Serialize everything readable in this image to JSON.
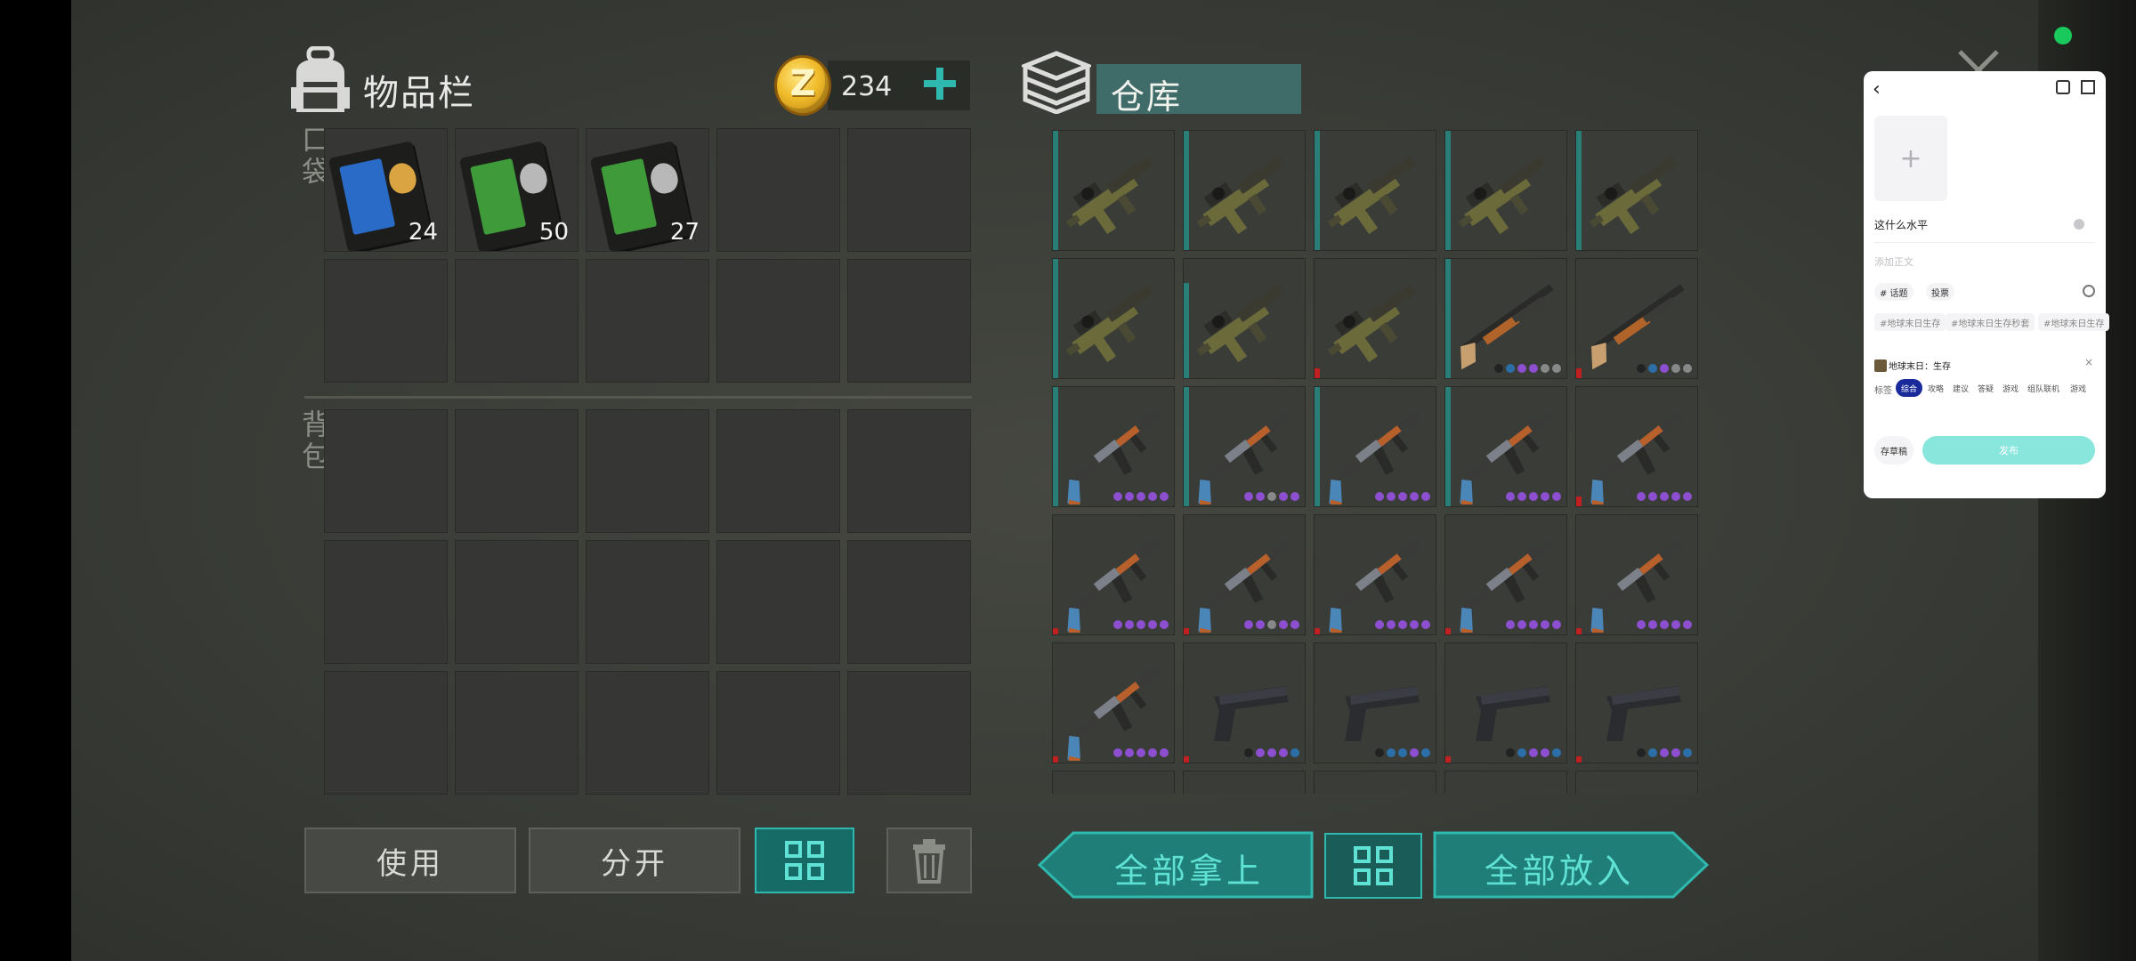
{
  "inventory": {
    "title": "物品栏",
    "pocket_label": "口袋",
    "backpack_label": "背包",
    "coins": "234",
    "pocket_slots": [
      {
        "type": "keycard-blue",
        "qty": "24"
      },
      {
        "type": "keycard-green",
        "qty": "50"
      },
      {
        "type": "keycard-green",
        "qty": "27"
      },
      {
        "type": "empty",
        "qty": ""
      },
      {
        "type": "empty",
        "qty": ""
      },
      {
        "type": "empty",
        "qty": ""
      },
      {
        "type": "empty",
        "qty": ""
      },
      {
        "type": "empty",
        "qty": ""
      },
      {
        "type": "empty",
        "qty": ""
      },
      {
        "type": "empty",
        "qty": ""
      }
    ],
    "backpack_slot_count": 15
  },
  "warehouse": {
    "title": "仓库",
    "items": [
      {
        "type": "grenade-launcher",
        "bar": "#2a7e78",
        "bar_h": 1.0,
        "dots": []
      },
      {
        "type": "grenade-launcher",
        "bar": "#2a7e78",
        "bar_h": 1.0,
        "dots": []
      },
      {
        "type": "grenade-launcher",
        "bar": "#2a7e78",
        "bar_h": 1.0,
        "dots": []
      },
      {
        "type": "grenade-launcher",
        "bar": "#2a7e78",
        "bar_h": 1.0,
        "dots": []
      },
      {
        "type": "grenade-launcher",
        "bar": "#2a7e78",
        "bar_h": 1.0,
        "dots": []
      },
      {
        "type": "grenade-launcher",
        "bar": "#2a7e78",
        "bar_h": 1.0,
        "dots": []
      },
      {
        "type": "grenade-launcher",
        "bar": "#2a7e78",
        "bar_h": 0.8,
        "dots": []
      },
      {
        "type": "grenade-launcher",
        "bar": "#c02020",
        "bar_h": 0.08,
        "dots": []
      },
      {
        "type": "shotgun",
        "bar": "#2a7e78",
        "bar_h": 1.0,
        "dots": [
          "#222",
          "#2c6fa8",
          "#8c4fd0",
          "#8c4fd0",
          "#888888",
          "#888888"
        ]
      },
      {
        "type": "shotgun",
        "bar": "#c02020",
        "bar_h": 0.08,
        "dots": [
          "#222",
          "#2c6fa8",
          "#8c4fd0",
          "#888888",
          "#888888"
        ]
      },
      {
        "type": "ak",
        "bar": "#2a7e78",
        "bar_h": 1.0,
        "dots": [
          "#8c4fd0",
          "#8c4fd0",
          "#8c4fd0",
          "#8c4fd0",
          "#8c4fd0"
        ]
      },
      {
        "type": "ak",
        "bar": "#2a7e78",
        "bar_h": 1.0,
        "dots": [
          "#8c4fd0",
          "#8c4fd0",
          "#888888",
          "#8c4fd0",
          "#8c4fd0"
        ]
      },
      {
        "type": "ak",
        "bar": "#2a7e78",
        "bar_h": 1.0,
        "dots": [
          "#8c4fd0",
          "#8c4fd0",
          "#8c4fd0",
          "#8c4fd0",
          "#8c4fd0"
        ]
      },
      {
        "type": "ak",
        "bar": "#2a7e78",
        "bar_h": 1.0,
        "dots": [
          "#8c4fd0",
          "#8c4fd0",
          "#8c4fd0",
          "#8c4fd0",
          "#8c4fd0"
        ]
      },
      {
        "type": "ak",
        "bar": "#c02020",
        "bar_h": 0.08,
        "dots": [
          "#8c4fd0",
          "#8c4fd0",
          "#8c4fd0",
          "#8c4fd0",
          "#8c4fd0"
        ]
      },
      {
        "type": "ak",
        "bar": "#c02020",
        "bar_h": 0.05,
        "dots": [
          "#8c4fd0",
          "#8c4fd0",
          "#8c4fd0",
          "#8c4fd0",
          "#8c4fd0"
        ]
      },
      {
        "type": "ak",
        "bar": "#c02020",
        "bar_h": 0.05,
        "dots": [
          "#8c4fd0",
          "#8c4fd0",
          "#888888",
          "#8c4fd0",
          "#8c4fd0"
        ]
      },
      {
        "type": "ak",
        "bar": "#c02020",
        "bar_h": 0.05,
        "dots": [
          "#8c4fd0",
          "#8c4fd0",
          "#8c4fd0",
          "#8c4fd0",
          "#8c4fd0"
        ]
      },
      {
        "type": "ak",
        "bar": "#c02020",
        "bar_h": 0.05,
        "dots": [
          "#8c4fd0",
          "#8c4fd0",
          "#8c4fd0",
          "#8c4fd0",
          "#8c4fd0"
        ]
      },
      {
        "type": "ak",
        "bar": "#c02020",
        "bar_h": 0.05,
        "dots": [
          "#8c4fd0",
          "#8c4fd0",
          "#8c4fd0",
          "#8c4fd0",
          "#8c4fd0"
        ]
      },
      {
        "type": "ak",
        "bar": "#c02020",
        "bar_h": 0.05,
        "dots": [
          "#8c4fd0",
          "#8c4fd0",
          "#8c4fd0",
          "#8c4fd0",
          "#8c4fd0"
        ]
      },
      {
        "type": "pistol",
        "bar": "#c02020",
        "bar_h": 0.05,
        "dots": [
          "#222",
          "#8c4fd0",
          "#8c4fd0",
          "#8c4fd0",
          "#2c6fa8"
        ]
      },
      {
        "type": "pistol",
        "bar": "#2a7e78",
        "bar_h": 0.0,
        "dots": [
          "#222",
          "#2c6fa8",
          "#2c6fa8",
          "#8c4fd0",
          "#2c6fa8"
        ]
      },
      {
        "type": "pistol",
        "bar": "#c02020",
        "bar_h": 0.05,
        "dots": [
          "#222",
          "#2c6fa8",
          "#8c4fd0",
          "#8c4fd0",
          "#2c6fa8"
        ]
      },
      {
        "type": "pistol",
        "bar": "#c02020",
        "bar_h": 0.05,
        "dots": [
          "#222",
          "#2c6fa8",
          "#8c4fd0",
          "#8c4fd0",
          "#2c6fa8"
        ]
      }
    ],
    "partial_row_count": 5
  },
  "buttons": {
    "use": "使用",
    "split": "分开",
    "take_all": "全部拿上",
    "put_all": "全部放入"
  },
  "overlay": {
    "text": "这什么水平",
    "placeholder": "添加正文",
    "chip_topic": "# 话题",
    "chip_vote": "投票",
    "hashtags": [
      "#地球末日生存",
      "#地球末日生存秒套",
      "#地球末日生存"
    ],
    "game_tag": "地球末日：生存",
    "tabs_label": "标签",
    "tabs": [
      "综合",
      "攻略",
      "建议",
      "答疑",
      "游戏",
      "组队联机",
      "游戏"
    ],
    "draft": "存草稿",
    "publish": "发布"
  },
  "colors": {
    "accent_teal": "#2fb8ad",
    "slot_bg": "#363734",
    "coin_gold": "#f0bb2a"
  }
}
